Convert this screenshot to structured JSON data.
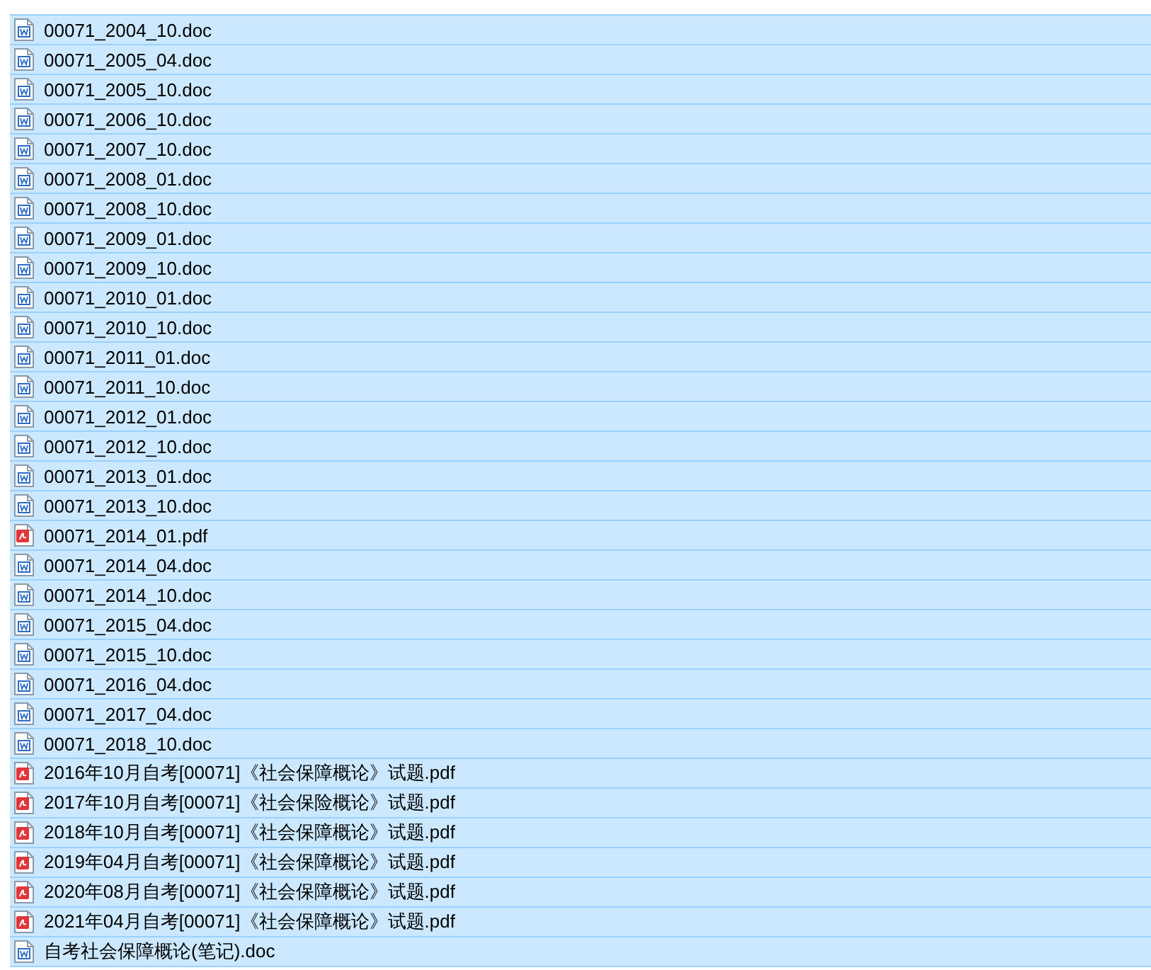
{
  "files": [
    {
      "name": "00071_2004_10.doc",
      "kind": "doc",
      "selected": true
    },
    {
      "name": "00071_2005_04.doc",
      "kind": "doc",
      "selected": true
    },
    {
      "name": "00071_2005_10.doc",
      "kind": "doc",
      "selected": true
    },
    {
      "name": "00071_2006_10.doc",
      "kind": "doc",
      "selected": true
    },
    {
      "name": "00071_2007_10.doc",
      "kind": "doc",
      "selected": true
    },
    {
      "name": "00071_2008_01.doc",
      "kind": "doc",
      "selected": true
    },
    {
      "name": "00071_2008_10.doc",
      "kind": "doc",
      "selected": true
    },
    {
      "name": "00071_2009_01.doc",
      "kind": "doc",
      "selected": true
    },
    {
      "name": "00071_2009_10.doc",
      "kind": "doc",
      "selected": true
    },
    {
      "name": "00071_2010_01.doc",
      "kind": "doc",
      "selected": true
    },
    {
      "name": "00071_2010_10.doc",
      "kind": "doc",
      "selected": true
    },
    {
      "name": "00071_2011_01.doc",
      "kind": "doc",
      "selected": true
    },
    {
      "name": "00071_2011_10.doc",
      "kind": "doc",
      "selected": true
    },
    {
      "name": "00071_2012_01.doc",
      "kind": "doc",
      "selected": true
    },
    {
      "name": "00071_2012_10.doc",
      "kind": "doc",
      "selected": true
    },
    {
      "name": "00071_2013_01.doc",
      "kind": "doc",
      "selected": true
    },
    {
      "name": "00071_2013_10.doc",
      "kind": "doc",
      "selected": true
    },
    {
      "name": "00071_2014_01.pdf",
      "kind": "pdf",
      "selected": true
    },
    {
      "name": "00071_2014_04.doc",
      "kind": "doc",
      "selected": true
    },
    {
      "name": "00071_2014_10.doc",
      "kind": "doc",
      "selected": true
    },
    {
      "name": "00071_2015_04.doc",
      "kind": "doc",
      "selected": true
    },
    {
      "name": "00071_2015_10.doc",
      "kind": "doc",
      "selected": true
    },
    {
      "name": "00071_2016_04.doc",
      "kind": "doc",
      "selected": true
    },
    {
      "name": "00071_2017_04.doc",
      "kind": "doc",
      "selected": true
    },
    {
      "name": "00071_2018_10.doc",
      "kind": "doc",
      "selected": true
    },
    {
      "name": "2016年10月自考[00071]《社会保障概论》试题.pdf",
      "kind": "pdf",
      "selected": true
    },
    {
      "name": "2017年10月自考[00071]《社会保险概论》试题.pdf",
      "kind": "pdf",
      "selected": true
    },
    {
      "name": "2018年10月自考[00071]《社会保障概论》试题.pdf",
      "kind": "pdf",
      "selected": true
    },
    {
      "name": "2019年04月自考[00071]《社会保障概论》试题.pdf",
      "kind": "pdf",
      "selected": true
    },
    {
      "name": "2020年08月自考[00071]《社会保障概论》试题.pdf",
      "kind": "pdf",
      "selected": true
    },
    {
      "name": "2021年04月自考[00071]《社会保障概论》试题.pdf",
      "kind": "pdf",
      "selected": true
    },
    {
      "name": "自考社会保障概论(笔记).doc",
      "kind": "doc",
      "selected": true
    }
  ]
}
